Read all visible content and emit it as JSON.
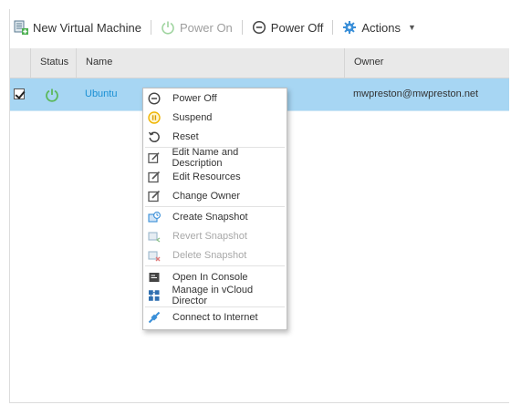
{
  "toolbar": {
    "new_vm_label": "New Virtual Machine",
    "power_on_label": "Power On",
    "power_off_label": "Power Off",
    "actions_label": "Actions"
  },
  "table": {
    "columns": [
      "Status",
      "Name",
      "Owner"
    ],
    "rows": [
      {
        "checked": true,
        "status_icon": "power-on-icon",
        "name": "Ubuntu",
        "owner": "mwpreston@mwpreston.net"
      }
    ]
  },
  "context_menu": {
    "items": [
      {
        "label": "Power Off",
        "icon": "power-off-icon",
        "enabled": true
      },
      {
        "label": "Suspend",
        "icon": "suspend-icon",
        "enabled": true
      },
      {
        "label": "Reset",
        "icon": "reset-icon",
        "enabled": true
      },
      {
        "label": "Edit Name and Description",
        "icon": "edit-icon",
        "enabled": true
      },
      {
        "label": "Edit Resources",
        "icon": "edit-icon",
        "enabled": true
      },
      {
        "label": "Change Owner",
        "icon": "edit-icon",
        "enabled": true
      },
      {
        "label": "Create Snapshot",
        "icon": "create-snapshot-icon",
        "enabled": true
      },
      {
        "label": "Revert Snapshot",
        "icon": "revert-snapshot-icon",
        "enabled": false
      },
      {
        "label": "Delete Snapshot",
        "icon": "delete-snapshot-icon",
        "enabled": false
      },
      {
        "label": "Open In Console",
        "icon": "console-icon",
        "enabled": true
      },
      {
        "label": "Manage in vCloud Director",
        "icon": "vcloud-icon",
        "enabled": true
      },
      {
        "label": "Connect to Internet",
        "icon": "connect-icon",
        "enabled": true
      }
    ]
  },
  "colors": {
    "selected_row": "#a7d6f3",
    "header_bg": "#e9e9e9",
    "link": "#1a8fd4",
    "power_green": "#5cb85c",
    "suspend_yellow": "#f0b400",
    "snapshot_blue": "#3a8fd8"
  }
}
